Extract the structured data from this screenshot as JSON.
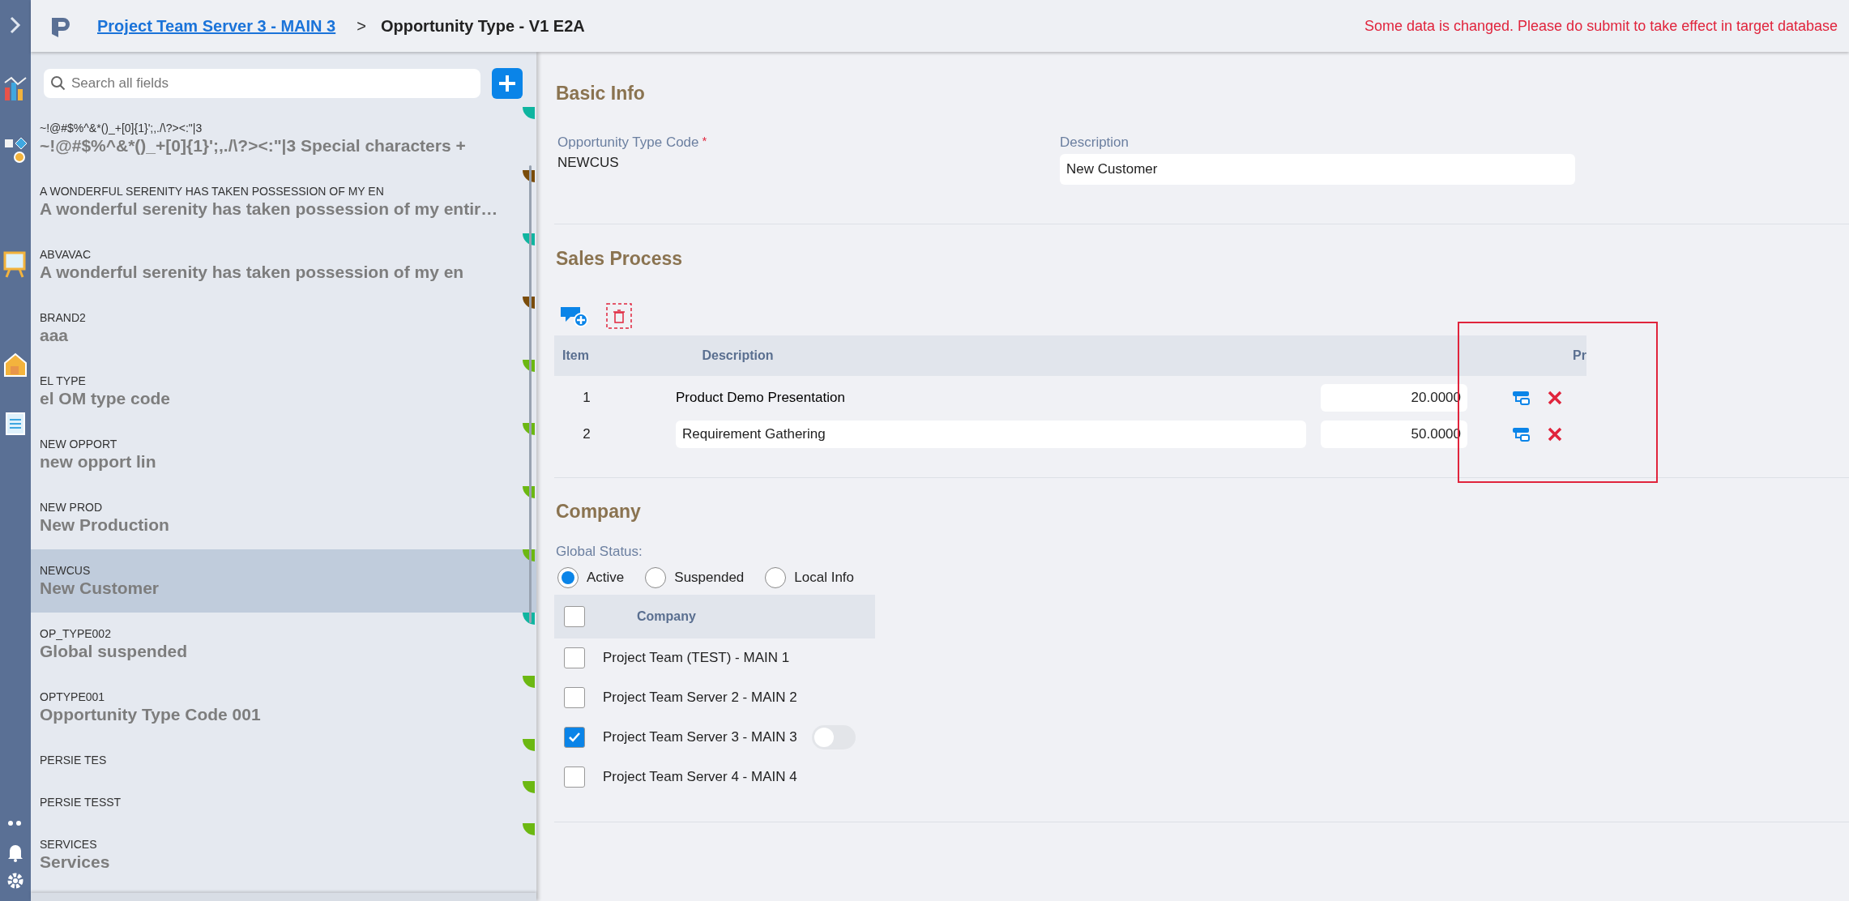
{
  "header": {
    "breadcrumb_link": "Project Team Server 3 - MAIN 3",
    "separator": ">",
    "title": "Opportunity Type - V1 E2A",
    "notice": "Some data is changed. Please do submit to take effect in target database"
  },
  "list": {
    "search": {
      "placeholder": "Search all fields"
    },
    "items": [
      {
        "code": "~!@#$%^&*()_+[0]{1}';,./\\?><:\"|3",
        "name": "~!@#$%^&*()_+[0]{1}';,./\\?><:\"|3 Special characters +",
        "color": "#0fb5a0",
        "selected": false
      },
      {
        "code": "A WONDERFUL SERENITY HAS TAKEN POSSESSION OF MY EN",
        "name": "A wonderful serenity has taken possession of my entir…",
        "color": "#7a4c0a",
        "selected": false
      },
      {
        "code": "ABVAVAC",
        "name": "A wonderful serenity has taken possession of my en",
        "color": "#0fb5a0",
        "selected": false
      },
      {
        "code": "BRAND2",
        "name": "aaa",
        "color": "#7a4c0a",
        "selected": false
      },
      {
        "code": "EL TYPE",
        "name": "el OM type code",
        "color": "#6cb812",
        "selected": false
      },
      {
        "code": "NEW OPPORT",
        "name": "new opport lin",
        "color": "#6cb812",
        "selected": false
      },
      {
        "code": "NEW PROD",
        "name": "New Production",
        "color": "#6cb812",
        "selected": false
      },
      {
        "code": "NEWCUS",
        "name": "New Customer",
        "color": "#6cb812",
        "selected": true
      },
      {
        "code": "OP_TYPE002",
        "name": "Global suspended",
        "color": "#0fb5a0",
        "selected": false
      },
      {
        "code": "OPTYPE001",
        "name": "Opportunity Type Code 001",
        "color": "#6cb812",
        "selected": false
      },
      {
        "code": "PERSIE TES",
        "color": "#6cb812",
        "selected": false
      },
      {
        "code": "PERSIE TESST",
        "color": "#6cb812",
        "selected": false
      },
      {
        "code": "SERVICES",
        "name": "Services",
        "color": "#6cb812",
        "selected": false
      }
    ]
  },
  "basic_info": {
    "title": "Basic Info",
    "code_label": "Opportunity Type Code",
    "required_mark": "*",
    "code_value": "NEWCUS",
    "description_label": "Description",
    "description_value": "New Customer"
  },
  "sales_process": {
    "title": "Sales Process",
    "columns": [
      "Item",
      "Description",
      "Pr"
    ],
    "rows": [
      {
        "item": "1",
        "description": "Product Demo Presentation",
        "value": "20.0000",
        "editing": false
      },
      {
        "item": "2",
        "description": "Requirement Gathering",
        "value": "50.0000",
        "editing": true
      }
    ]
  },
  "company": {
    "title": "Company",
    "status_label": "Global Status:",
    "statuses": [
      {
        "label": "Active",
        "selected": true
      },
      {
        "label": "Suspended",
        "selected": false
      },
      {
        "label": "Local Info",
        "selected": false
      }
    ],
    "header_checked": false,
    "column": "Company",
    "rows": [
      {
        "name": "Project Team (TEST) - MAIN 1",
        "checked": false
      },
      {
        "name": "Project Team Server 2 - MAIN 2",
        "checked": false
      },
      {
        "name": "Project Team Server 3 - MAIN 3",
        "checked": true,
        "toggle": {
          "on": false
        }
      },
      {
        "name": "Project Team Server 4 - MAIN 4",
        "checked": false
      }
    ]
  }
}
